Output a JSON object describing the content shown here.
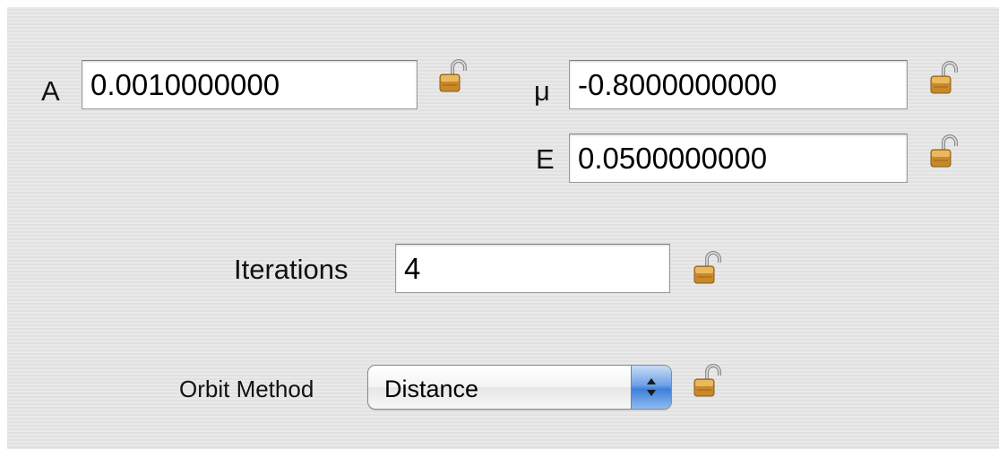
{
  "params": {
    "a": {
      "label": "A",
      "value": "0.0010000000"
    },
    "mu": {
      "label": "μ",
      "value": "-0.8000000000"
    },
    "e": {
      "label": "E",
      "value": "0.0500000000"
    },
    "iterations": {
      "label": "Iterations",
      "value": "4"
    }
  },
  "orbit_method": {
    "label": "Orbit Method",
    "selected": "Distance"
  },
  "icons": {
    "lock": "lock-open-icon",
    "popup_arrows": "up-down-arrows-icon"
  },
  "colors": {
    "panel_background": "#e6e6e6",
    "lock_gold": "#c8892a",
    "popup_arrow_blue": "#3f7fd8"
  }
}
